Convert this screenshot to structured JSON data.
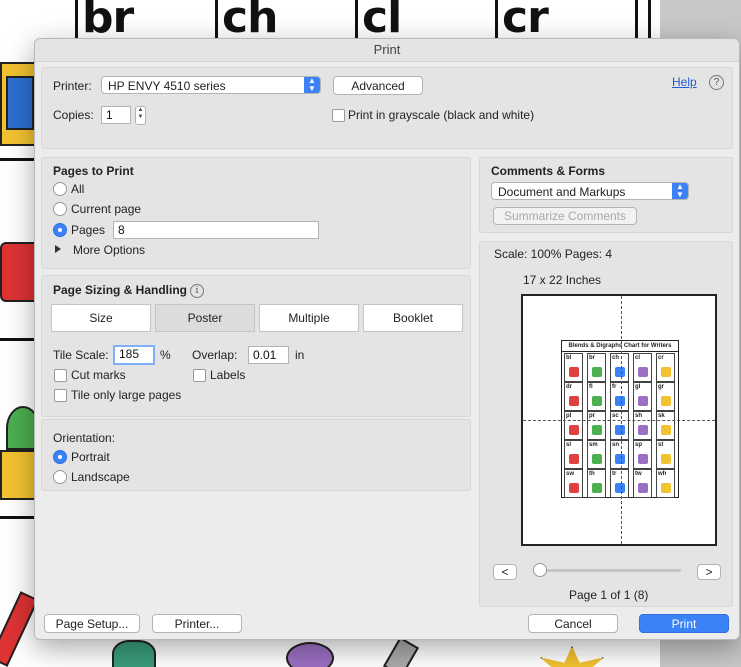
{
  "background_doc": {
    "letters": [
      "br",
      "ch",
      "cl",
      "cr"
    ]
  },
  "dialog": {
    "title": "Print",
    "printer_label": "Printer:",
    "printer_value": "HP ENVY 4510 series",
    "advanced_label": "Advanced",
    "help_label": "Help",
    "help_icon": "?",
    "copies_label": "Copies:",
    "copies_value": "1",
    "grayscale_label": "Print in grayscale (black and white)",
    "pages_to_print": {
      "heading": "Pages to Print",
      "all": "All",
      "current": "Current page",
      "pages": "Pages",
      "pages_value": "8",
      "selected": "pages",
      "more_options": "More Options"
    },
    "sizing": {
      "heading": "Page Sizing & Handling",
      "info_icon": "i",
      "tabs": [
        "Size",
        "Poster",
        "Multiple",
        "Booklet"
      ],
      "selected_tab": "Poster",
      "tile_scale_label": "Tile Scale:",
      "tile_scale_value": "185",
      "percent": "%",
      "overlap_label": "Overlap:",
      "overlap_value": "0.01",
      "overlap_unit": "in",
      "cut_marks": "Cut marks",
      "labels": "Labels",
      "tile_only": "Tile only large pages"
    },
    "orientation": {
      "heading": "Orientation:",
      "portrait": "Portrait",
      "landscape": "Landscape",
      "selected": "portrait"
    },
    "comments": {
      "heading": "Comments & Forms",
      "value": "Document and Markups",
      "summarize": "Summarize Comments"
    },
    "preview": {
      "scale_text": "Scale: 100% Pages: 4",
      "paper_size": "17 x 22 Inches",
      "chart_title": "Blends & Digraphs Chart for Writers",
      "cells": [
        "bl",
        "br",
        "ch",
        "cl",
        "cr",
        "dr",
        "fl",
        "fr",
        "gl",
        "gr",
        "pl",
        "pr",
        "sc",
        "sh",
        "sk",
        "sl",
        "sm",
        "sn",
        "sp",
        "st",
        "sw",
        "th",
        "tr",
        "tw",
        "wh"
      ],
      "prev": "<",
      "next": ">",
      "page_status": "Page 1 of 1 (8)"
    },
    "buttons": {
      "page_setup": "Page Setup...",
      "printer": "Printer...",
      "cancel": "Cancel",
      "print": "Print"
    }
  },
  "colors": {
    "accent": "#3b82f6",
    "dialog_bg": "#ececec",
    "link": "#1f5fd6"
  }
}
